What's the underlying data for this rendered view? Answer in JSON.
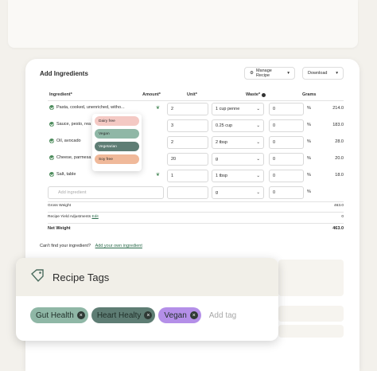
{
  "panel": {
    "title": "Add Ingredients",
    "manage_recipe": "Manage Recipe",
    "download": "Download"
  },
  "table": {
    "headers": {
      "ingredient": "Ingredient*",
      "amount": "Amount*",
      "unit": "Unit*",
      "waste": "Waste*",
      "grams": "Grams"
    },
    "rows": [
      {
        "ingredient": "Pasta, cooked, unenriched, witho...",
        "amount": "2",
        "unit": "1 cup penne",
        "waste": "0",
        "pct": "%",
        "grams": "214.0"
      },
      {
        "ingredient": "Sauce, pesto, rea",
        "amount": "3",
        "unit": "0.25 cup",
        "waste": "0",
        "pct": "%",
        "grams": "183.0"
      },
      {
        "ingredient": "Oil, avocado",
        "amount": "2",
        "unit": "2 tbsp",
        "waste": "0",
        "pct": "%",
        "grams": "28.0"
      },
      {
        "ingredient": "Cheese, parmesa",
        "amount": "20",
        "unit": "g",
        "waste": "0",
        "pct": "%",
        "grams": "20.0"
      },
      {
        "ingredient": "Salt, table",
        "amount": "1",
        "unit": "1 tbsp",
        "waste": "0",
        "pct": "%",
        "grams": "18.0"
      }
    ],
    "new_row": {
      "placeholder": "Add ingredient",
      "unit": "g",
      "waste": "0",
      "pct": "%"
    }
  },
  "summary": {
    "gross_label": "Gross Weight",
    "gross_value": "463.0",
    "yield_label": "Recipe Yield Adjustments",
    "yield_link": "Edit",
    "yield_value": "0",
    "net_label": "Net Weight",
    "net_value": "463.0"
  },
  "cant_find": {
    "text": "Can't find your ingredient?",
    "link": "Add your own ingredient"
  },
  "diet_popup": {
    "items": [
      {
        "label": "Dairy free",
        "color": "#f4c9c4"
      },
      {
        "label": "Vegan",
        "color": "#8fb7a6"
      },
      {
        "label": "Vegetarian",
        "color": "#5e7d74"
      },
      {
        "label": "Soy free",
        "color": "#f0b99a"
      }
    ]
  },
  "recipe_tags": {
    "title": "Recipe Tags",
    "tags": [
      {
        "label": "Gut Health",
        "color": "#8fb7a6"
      },
      {
        "label": "Heart Healty",
        "color": "#5e7d74"
      },
      {
        "label": "Vegan",
        "color": "#b48fe8"
      }
    ],
    "placeholder": "Add tag"
  }
}
